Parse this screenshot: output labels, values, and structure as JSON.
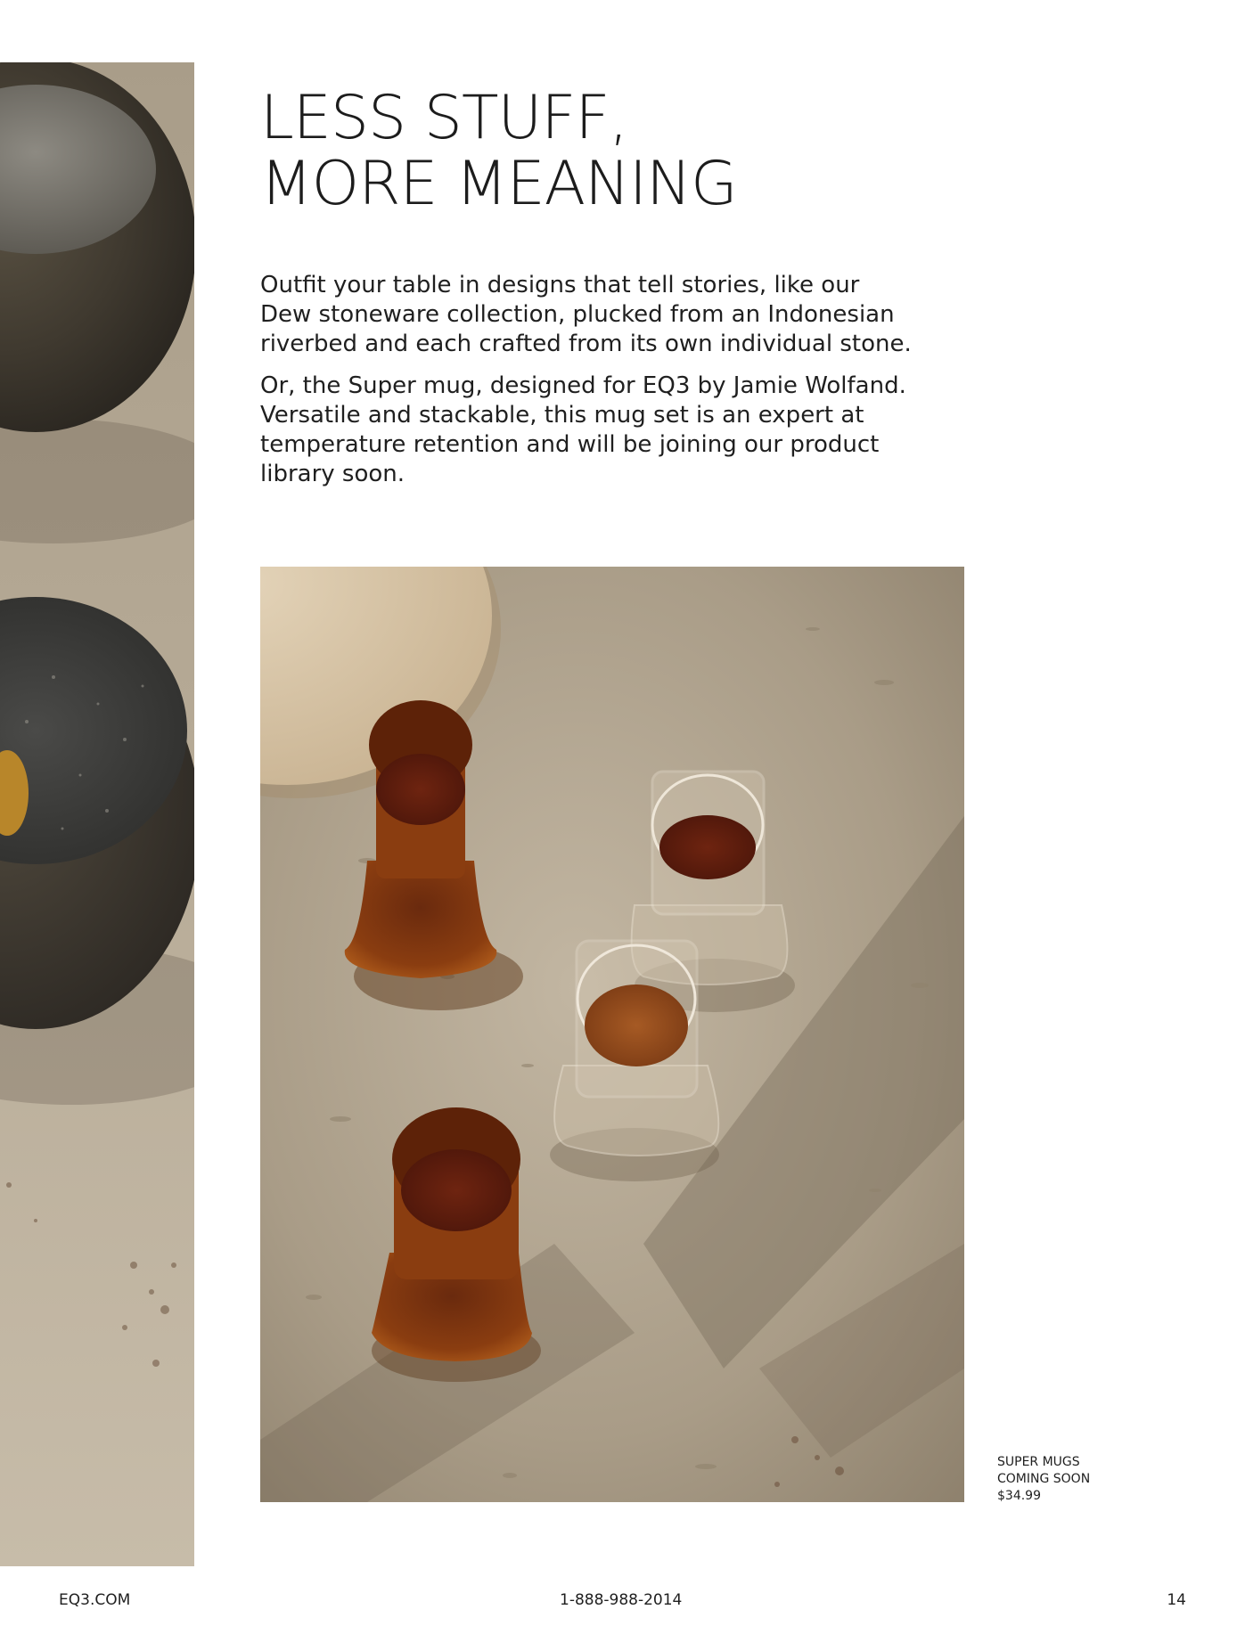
{
  "headline": {
    "line1": "LESS STUFF,",
    "line2": "MORE MEANING"
  },
  "body": {
    "paragraph1_lines": [
      "Outfit your table in designs that tell stories, like our",
      "Dew stoneware collection, plucked from an Indonesian",
      "riverbed and each crafted from its own individual stone."
    ],
    "paragraph2_lines": [
      "Or, the Super mug, designed for EQ3 by Jamie Wolfand.",
      "Versatile and stackable, this mug set is an expert at",
      "temperature retention and will be joining our product",
      "library soon."
    ]
  },
  "caption": {
    "line1": "SUPER MUGS",
    "line2": "COMING SOON",
    "line3": "$34.99"
  },
  "footer": {
    "website": "EQ3.COM",
    "phone": "1-888-988-2014",
    "page_number": "14"
  },
  "images": {
    "side_photo": "stoneware-bowls-photo",
    "main_photo": "super-mugs-photo"
  },
  "colors": {
    "text": "#1c1c1c",
    "amber_glass": "#8a3d10",
    "stone_surface": "#b9ac98"
  }
}
